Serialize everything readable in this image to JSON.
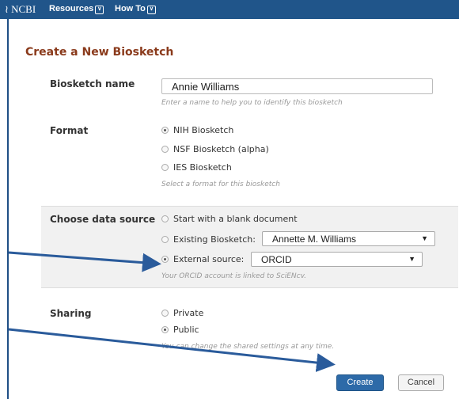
{
  "topbar": {
    "logo": "NCBI",
    "resources": "Resources",
    "howto": "How To"
  },
  "title": "Create a New Biosketch",
  "name_section": {
    "label": "Biosketch name",
    "value": "Annie Williams",
    "hint": "Enter a name to help you to identify this biosketch"
  },
  "format_section": {
    "label": "Format",
    "options": [
      "NIH Biosketch",
      "NSF Biosketch (alpha)",
      "IES Biosketch"
    ],
    "selected": "NIH Biosketch",
    "hint": "Select a format for this biosketch"
  },
  "source_section": {
    "label": "Choose data source",
    "opt_blank": "Start with a blank document",
    "opt_existing": "Existing Biosketch:",
    "existing_value": "Annette M. Williams",
    "opt_external": "External source:",
    "external_value": "ORCID",
    "selected": "External source:",
    "hint": "Your ORCID account is linked to SciENcv."
  },
  "sharing_section": {
    "label": "Sharing",
    "opt_private": "Private",
    "opt_public": "Public",
    "selected": "Public",
    "hint": "You can change the shared settings at any time."
  },
  "buttons": {
    "create": "Create",
    "cancel": "Cancel"
  },
  "colors": {
    "topbar": "#20558a",
    "title": "#8a3a1b",
    "create_button": "#2d6aa8",
    "arrow": "#2a5b9b"
  }
}
